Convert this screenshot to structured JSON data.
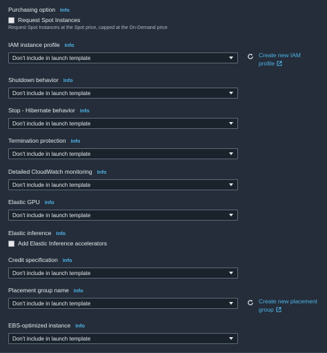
{
  "info_label": "Info",
  "purchasing": {
    "title": "Purchasing option",
    "checkbox_label": "Request Spot Instances",
    "description": "Request Spot Instances at the Spot price, capped at the On-Demand price"
  },
  "iam_profile": {
    "label": "IAM instance profile",
    "value": "Don't include in launch template",
    "side_link_line1": "Create new IAM",
    "side_link_line2": "profile"
  },
  "shutdown": {
    "label": "Shutdown behavior",
    "value": "Don't include in launch template"
  },
  "stop_hibernate": {
    "label": "Stop - Hibernate behavior",
    "value": "Don't include in launch template"
  },
  "termination": {
    "label": "Termination protection",
    "value": "Don't include in launch template"
  },
  "cloudwatch": {
    "label": "Detailed CloudWatch monitoring",
    "value": "Don't include in launch template"
  },
  "elastic_gpu": {
    "label": "Elastic GPU",
    "value": "Don't include in launch template"
  },
  "elastic_inference": {
    "label": "Elastic inference",
    "checkbox_label": "Add Elastic Inference accelerators"
  },
  "credit_spec": {
    "label": "Credit specification",
    "value": "Don't include in launch template"
  },
  "placement_group": {
    "label": "Placement group name",
    "value": "Don't include in launch template",
    "side_link_line1": "Create new placement",
    "side_link_line2": "group"
  },
  "ebs_optimized": {
    "label": "EBS-optimized instance",
    "value": "Don't include in launch template"
  },
  "colors": {
    "background": "#242d39",
    "link": "#4fb2e8",
    "select_bg": "#1a222c",
    "select_border": "#5f6b7a"
  },
  "icons": {
    "refresh": "refresh-icon",
    "external": "external-link-icon",
    "caret": "caret-down-icon"
  }
}
